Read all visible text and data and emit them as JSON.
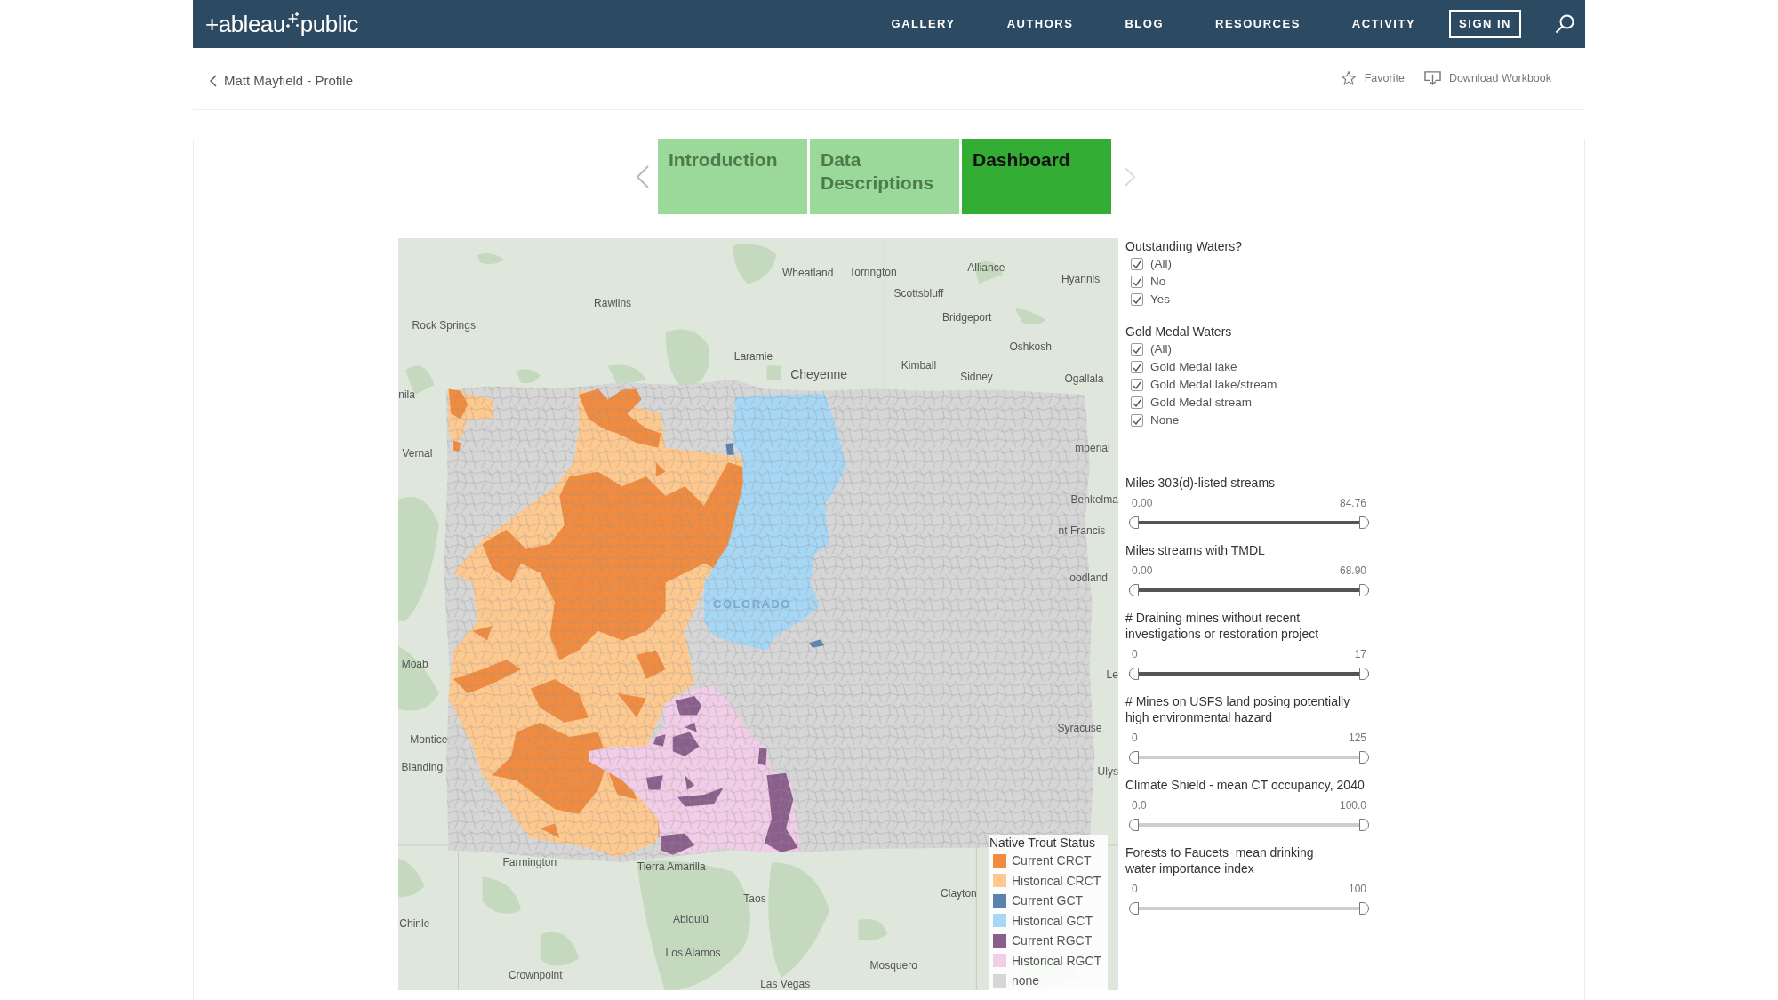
{
  "header": {
    "logo": {
      "prefix": "+ableau",
      "suffix": "public"
    },
    "links": [
      "GALLERY",
      "AUTHORS",
      "BLOG",
      "RESOURCES",
      "ACTIVITY"
    ],
    "sign_in": "SIGN IN"
  },
  "subheader": {
    "back_link": "Matt Mayfield - Profile",
    "actions": [
      {
        "kind": "favorite",
        "label": "Favorite"
      },
      {
        "kind": "download",
        "label": "Download Workbook"
      }
    ]
  },
  "story_tabs": [
    {
      "label": "Introduction",
      "selected": false
    },
    {
      "label": "Data Descriptions",
      "selected": false
    },
    {
      "label": "Dashboard",
      "selected": true
    }
  ],
  "map": {
    "place_labels": [
      "Wheatland",
      "Torrington",
      "Alliance",
      "Hyannis",
      "Rawlins",
      "Scottsbluff",
      "Bridgeport",
      "Rock Springs",
      "Oshkosh",
      "Laramie",
      "Cheyenne",
      "Kimball",
      "Sidney",
      "Ogallala",
      "nila",
      "Vernal",
      "mperial",
      "Benkelma",
      "nt Francis",
      "oodland",
      "Moab",
      "Le",
      "Syracuse",
      "Montice",
      "Blanding",
      "Ulys",
      "Farmington",
      "Tierra Amarilla",
      "Taos",
      "Clayton",
      "Chinle",
      "Abiquiú",
      "Los Alamos",
      "Mosquero",
      "Crownpoint",
      "Las Vegas"
    ],
    "state_label": "COLORADO",
    "legend": {
      "title": "Native Trout Status",
      "items": [
        {
          "label": "Current CRCT",
          "color": "#f08b3f"
        },
        {
          "label": "Historical CRCT",
          "color": "#fec98f"
        },
        {
          "label": "Current GCT",
          "color": "#5b82ad"
        },
        {
          "label": "Historical GCT",
          "color": "#a6d7f5"
        },
        {
          "label": "Current RGCT",
          "color": "#8b5f8c"
        },
        {
          "label": "Historical RGCT",
          "color": "#f1cde8"
        },
        {
          "label": "none",
          "color": "#d6d6d6"
        }
      ]
    }
  },
  "filters": [
    {
      "title": "Outstanding Waters?",
      "options": [
        {
          "label": "(All)",
          "checked": true
        },
        {
          "label": "No",
          "checked": true
        },
        {
          "label": "Yes",
          "checked": true
        }
      ]
    },
    {
      "title": "Gold Medal Waters",
      "options": [
        {
          "label": "(All)",
          "checked": true
        },
        {
          "label": "Gold Medal lake",
          "checked": true
        },
        {
          "label": "Gold Medal lake/stream",
          "checked": true
        },
        {
          "label": "Gold Medal stream",
          "checked": true
        },
        {
          "label": "None",
          "checked": true
        }
      ]
    }
  ],
  "range_filters": [
    {
      "title": "Miles 303(d)-listed streams",
      "min_label": "0.00",
      "max_label": "84.76",
      "level": 1,
      "active": true
    },
    {
      "title": "Miles streams with TMDL",
      "min_label": "0.00",
      "max_label": "68.90",
      "level": 1,
      "active": true
    },
    {
      "title": "# Draining mines without recent\ninvestigations or restoration project",
      "min_label": "0",
      "max_label": "17",
      "level": 1,
      "active": true
    },
    {
      "title": "# Mines on USFS land posing potentially\nhigh environmental hazard",
      "min_label": "0",
      "max_label": "125",
      "level": 1,
      "active": false
    },
    {
      "title": "Climate Shield - mean CT occupancy, 2040",
      "min_label": "0.0",
      "max_label": "100.0",
      "level": 1,
      "active": false
    },
    {
      "title": "Forests to Faucets  mean drinking\nwater importance index",
      "min_label": "0",
      "max_label": "100",
      "level": 1,
      "active": false
    }
  ]
}
